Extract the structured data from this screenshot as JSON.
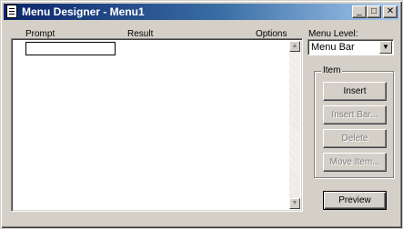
{
  "window": {
    "title": "Menu Designer - Menu1",
    "controls": {
      "minimize": "_",
      "maximize": "□",
      "close": "✕"
    }
  },
  "columns": {
    "prompt": "Prompt",
    "result": "Result",
    "options": "Options"
  },
  "menu_level": {
    "label": "Menu Level:",
    "selected": "Menu Bar",
    "arrow_icon": "▼"
  },
  "item_group": {
    "label": "Item",
    "buttons": {
      "insert": "Insert",
      "insert_bar": "Insert Bar...",
      "delete": "Delete",
      "move_item": "Move Item..."
    }
  },
  "preview_label": "Preview",
  "scrollbar": {
    "up": "▲",
    "down": "▼"
  }
}
